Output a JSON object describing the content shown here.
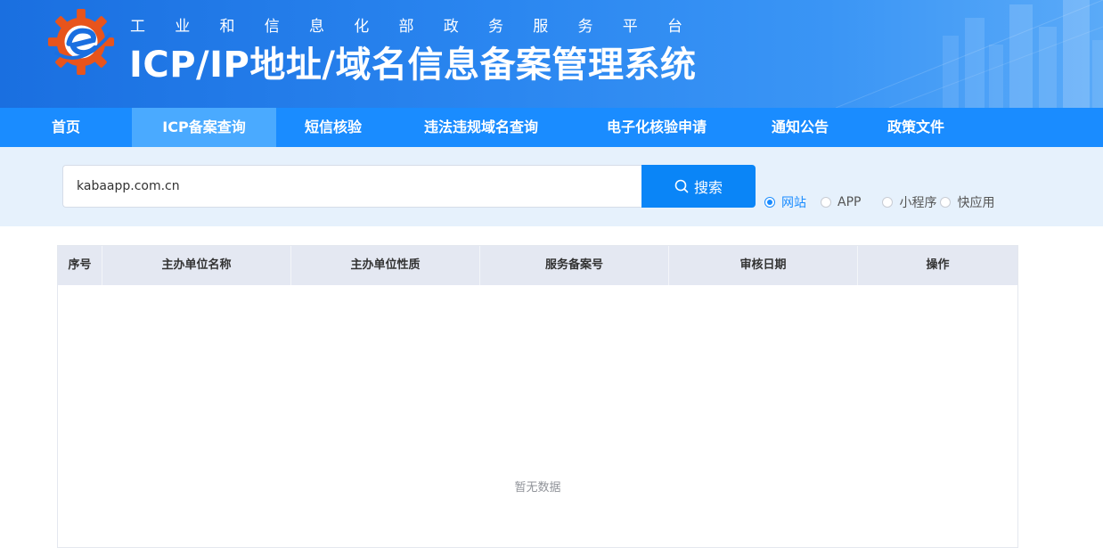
{
  "header": {
    "subtitle_chars": [
      "工",
      "业",
      "和",
      "信",
      "息",
      "化",
      "部",
      "政",
      "务",
      "服",
      "务",
      "平",
      "台"
    ],
    "title": "ICP/IP地址/域名信息备案管理系统",
    "logo_icon": "miit-gear-logo-icon",
    "colors": {
      "header_blue": "#1a6fe0",
      "nav_blue": "#1a8cff",
      "nav_active": "#4aaaff"
    }
  },
  "nav": {
    "items": [
      {
        "label": "首页"
      },
      {
        "label": "ICP备案查询"
      },
      {
        "label": "短信核验"
      },
      {
        "label": "违法违规域名查询"
      },
      {
        "label": "电子化核验申请"
      },
      {
        "label": "通知公告"
      },
      {
        "label": "政策文件"
      }
    ],
    "active": "ICP备案查询"
  },
  "search": {
    "value": "kabaapp.com.cn",
    "button_label": "搜索",
    "button_icon": "search-icon",
    "types": [
      {
        "label": "网站",
        "checked": true
      },
      {
        "label": "APP",
        "checked": false
      },
      {
        "label": "小程序",
        "checked": false
      },
      {
        "label": "快应用",
        "checked": false
      }
    ]
  },
  "table": {
    "columns": [
      "序号",
      "主办单位名称",
      "主办单位性质",
      "服务备案号",
      "审核日期",
      "操作"
    ],
    "rows": [],
    "empty_text": "暂无数据"
  }
}
